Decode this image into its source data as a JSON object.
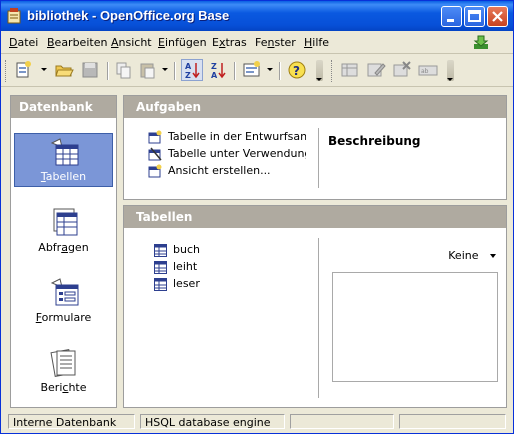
{
  "window": {
    "title": "bibliothek - OpenOffice.org Base"
  },
  "menubar": {
    "items": [
      {
        "label": "Datei",
        "accel": "D",
        "rest": "atei"
      },
      {
        "label": "Bearbeiten",
        "accel": "B",
        "rest": "earbeiten"
      },
      {
        "label": "Ansicht",
        "accel": "A",
        "rest": "nsicht"
      },
      {
        "label": "Einfügen",
        "accel": "E",
        "rest": "infügen"
      },
      {
        "label": "Extras",
        "accel": "x",
        "pre": "E",
        "rest": "tras"
      },
      {
        "label": "Fenster",
        "accel": "n",
        "pre": "Fe",
        "rest": "ster"
      },
      {
        "label": "Hilfe",
        "accel": "H",
        "rest": "ilfe"
      }
    ]
  },
  "toolbar": {
    "icons": [
      "new-document-icon",
      "open-folder-icon",
      "save-icon",
      "copy-icon",
      "paste-icon",
      "sort-ascending-icon",
      "sort-descending-icon",
      "form-icon",
      "help-icon",
      "table-design-icon",
      "edit-icon",
      "delete-icon",
      "rename-icon"
    ]
  },
  "sidebar": {
    "header": "Datenbank",
    "items": [
      {
        "label": "Tabellen",
        "accel": "T",
        "rest": "abellen",
        "icon": "tables-icon",
        "selected": true
      },
      {
        "label": "Abfragen",
        "pre": "Abfr",
        "accel": "a",
        "rest": "gen",
        "icon": "queries-icon",
        "selected": false
      },
      {
        "label": "Formulare",
        "accel": "F",
        "rest": "ormulare",
        "icon": "forms-icon",
        "selected": false
      },
      {
        "label": "Berichte",
        "pre": "Beri",
        "accel": "c",
        "rest": "hte",
        "icon": "reports-icon",
        "selected": false
      }
    ]
  },
  "tasks": {
    "header": "Aufgaben",
    "items": [
      {
        "label": "Tabelle in der Entwurfsansicht erstellen...",
        "icon": "table-design-icon"
      },
      {
        "label": "Tabelle unter Verwendung des Assistenten erstellen...",
        "icon": "table-wizard-icon"
      },
      {
        "label": "Ansicht erstellen...",
        "icon": "view-create-icon"
      }
    ],
    "description_title": "Beschreibung"
  },
  "tables": {
    "header": "Tabellen",
    "items": [
      "buch",
      "leiht",
      "leser"
    ],
    "preview_option": "Keine"
  },
  "statusbar": {
    "fields": [
      "Interne Datenbank",
      "HSQL database engine",
      "",
      ""
    ]
  }
}
